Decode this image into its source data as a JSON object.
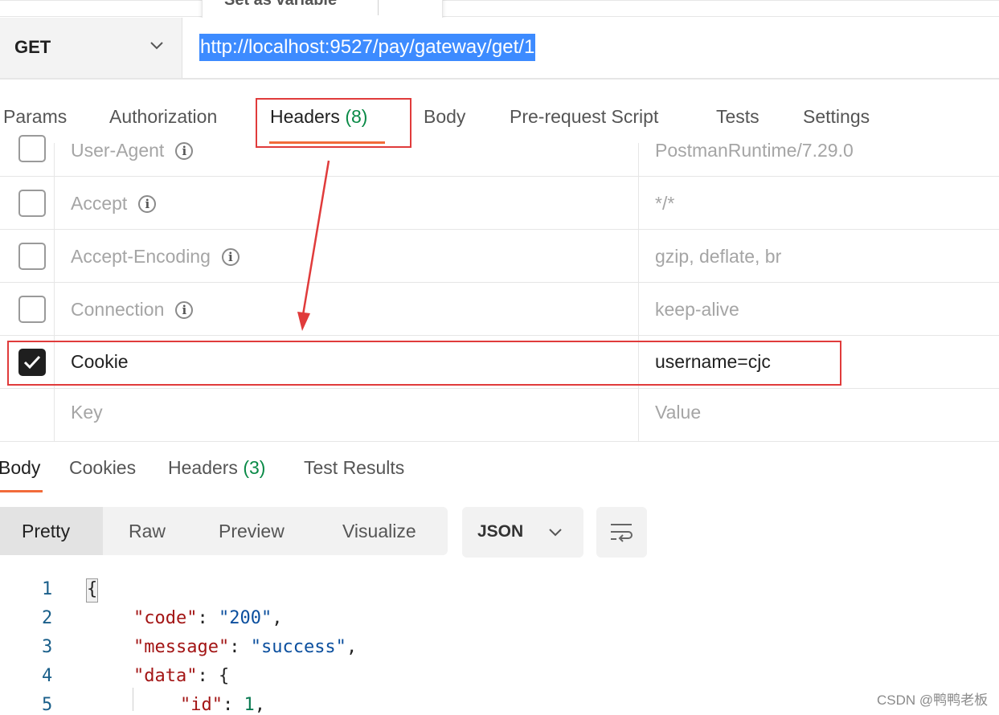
{
  "popup": {
    "text": "Set as variable"
  },
  "request": {
    "method": "GET",
    "url": "http://localhost:9527/pay/gateway/get/1"
  },
  "request_tabs": {
    "params": "Params",
    "authorization": "Authorization",
    "headers": "Headers",
    "headers_count": "(8)",
    "body": "Body",
    "pre_request": "Pre-request Script",
    "tests": "Tests",
    "settings": "Settings"
  },
  "headers": [
    {
      "key": "User-Agent",
      "value": "PostmanRuntime/7.29.0",
      "checked": false
    },
    {
      "key": "Accept",
      "value": "*/*",
      "checked": false
    },
    {
      "key": "Accept-Encoding",
      "value": "gzip, deflate, br",
      "checked": false
    },
    {
      "key": "Connection",
      "value": "keep-alive",
      "checked": false
    },
    {
      "key": "Cookie",
      "value": "username=cjc",
      "checked": true
    },
    {
      "key": "Key",
      "value": "Value",
      "checked": false
    }
  ],
  "response_tabs": {
    "body": "Body",
    "cookies": "Cookies",
    "headers": "Headers",
    "headers_count": "(3)",
    "test_results": "Test Results"
  },
  "view": {
    "pretty": "Pretty",
    "raw": "Raw",
    "preview": "Preview",
    "visualize": "Visualize",
    "format": "JSON"
  },
  "code": {
    "line_numbers": [
      "1",
      "2",
      "3",
      "4",
      "5"
    ],
    "l1": "{",
    "l2_key": "\"code\"",
    "l2_val": "\"200\"",
    "l3_key": "\"message\"",
    "l3_val": "\"success\"",
    "l4_key": "\"data\"",
    "l4_val": "{",
    "l5_key": "\"id\"",
    "l5_val": "1"
  },
  "watermark": "CSDN @鸭鸭老板",
  "colors": {
    "accent": "#f26b3a",
    "annotation": "#e03b3b",
    "selection": "#3d8bff",
    "count": "#0a8a47"
  }
}
